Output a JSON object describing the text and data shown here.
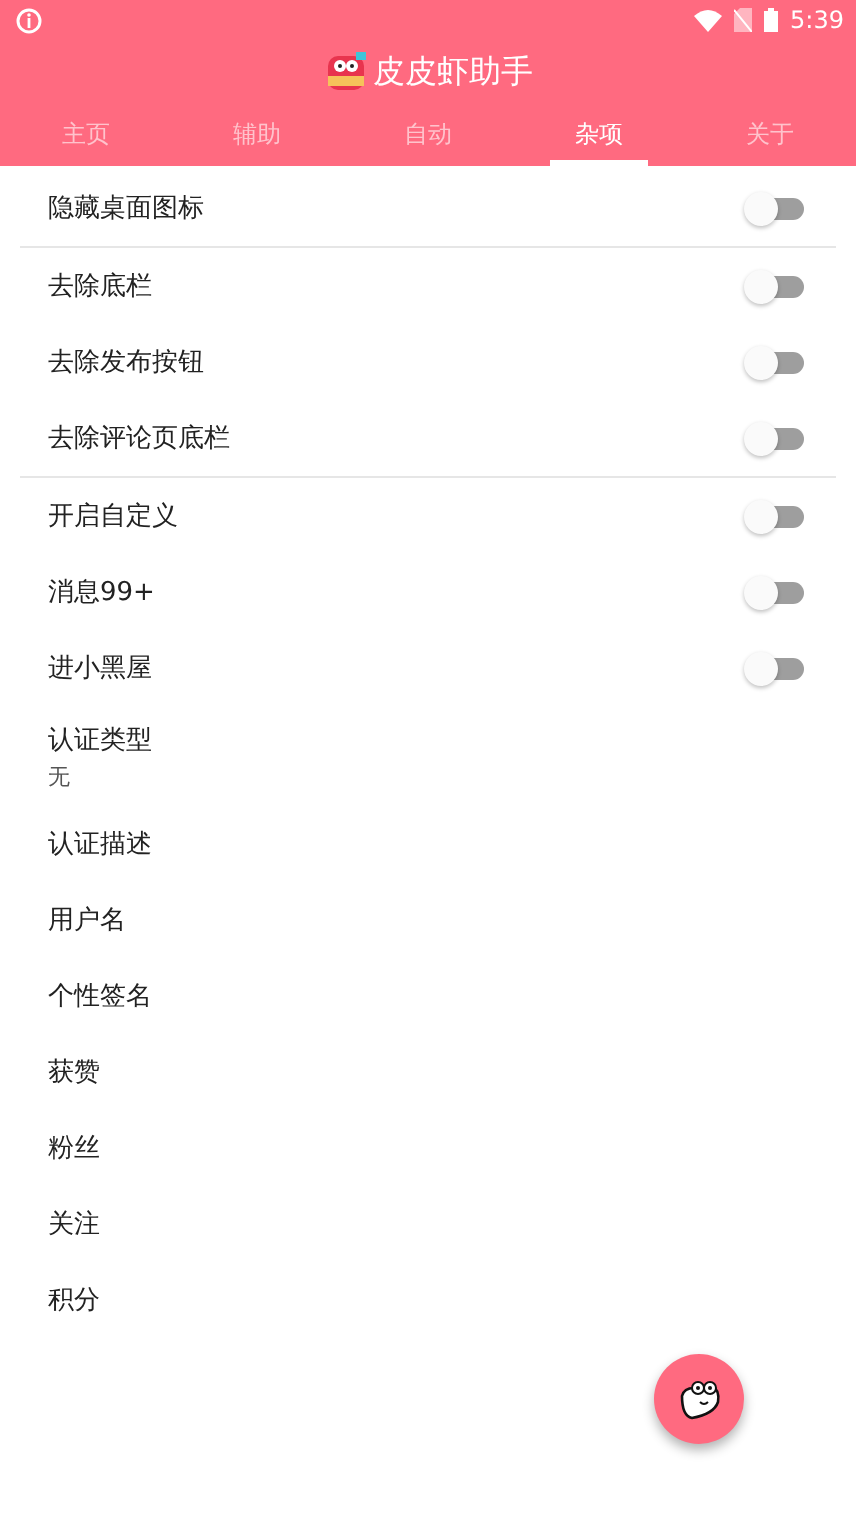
{
  "status_bar": {
    "time": "5:39"
  },
  "app_bar": {
    "title": "皮皮虾助手"
  },
  "tabs": [
    {
      "label": "主页",
      "selected": false
    },
    {
      "label": "辅助",
      "selected": false
    },
    {
      "label": "自动",
      "selected": false
    },
    {
      "label": "杂项",
      "selected": true
    },
    {
      "label": "关于",
      "selected": false
    }
  ],
  "settings": [
    {
      "kind": "switch",
      "label": "隐藏桌面图标",
      "on": false,
      "divider_after": true
    },
    {
      "kind": "switch",
      "label": "去除底栏",
      "on": false
    },
    {
      "kind": "switch",
      "label": "去除发布按钮",
      "on": false
    },
    {
      "kind": "switch",
      "label": "去除评论页底栏",
      "on": false,
      "divider_after": true
    },
    {
      "kind": "switch",
      "label": "开启自定义",
      "on": false
    },
    {
      "kind": "switch",
      "label": "消息99+",
      "on": false
    },
    {
      "kind": "switch",
      "label": "进小黑屋",
      "on": false
    },
    {
      "kind": "text",
      "label": "认证类型",
      "value": "无"
    },
    {
      "kind": "text",
      "label": "认证描述"
    },
    {
      "kind": "text",
      "label": "用户名"
    },
    {
      "kind": "text",
      "label": "个性签名"
    },
    {
      "kind": "text",
      "label": "获赞"
    },
    {
      "kind": "text",
      "label": "粉丝"
    },
    {
      "kind": "text",
      "label": "关注"
    },
    {
      "kind": "text",
      "label": "积分"
    }
  ]
}
